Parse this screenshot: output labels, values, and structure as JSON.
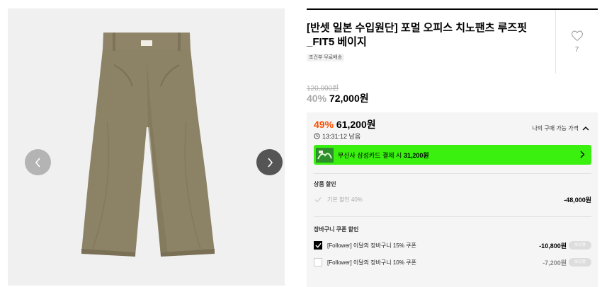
{
  "gallery": {
    "prev_icon": "chevron-left-icon",
    "next_icon": "chevron-right-icon",
    "product_image": "beige-chino-pants"
  },
  "product": {
    "title": "[반셋 일본 수입원단] 포멀 오피스 치노팬츠 루즈핏_FIT5 베이지",
    "shipping_tag": "조건부 무료배송",
    "like_count": "7",
    "like_icon": "heart-outline-icon"
  },
  "price": {
    "original": "120,000원",
    "discount_pct": "40%",
    "sale": "72,000원"
  },
  "benefit": {
    "pct": "49%",
    "price": "61,200원",
    "timer": "13:31:12 남음",
    "toggle_label": "나의 구매 가능 가격",
    "promo_text": "무신사 삼성카드 결제 시",
    "promo_amount": "31,200원",
    "accent": "#39f00e",
    "highlight": "#ff4d00"
  },
  "product_discount": {
    "title": "상품 할인",
    "label": "기본 할인 40%",
    "amount": "-48,000원"
  },
  "cart_coupon": {
    "title": "장바구니 쿠폰 할인",
    "items": [
      {
        "label": "[Follower] 이달의 장바구니 15% 쿠폰",
        "amount": "-10,800원",
        "badge": "보유중",
        "checked": true
      },
      {
        "label": "[Follower] 이달의 장바구니 10% 쿠폰",
        "amount": "-7,200원",
        "badge": "보유중",
        "checked": false
      }
    ]
  }
}
